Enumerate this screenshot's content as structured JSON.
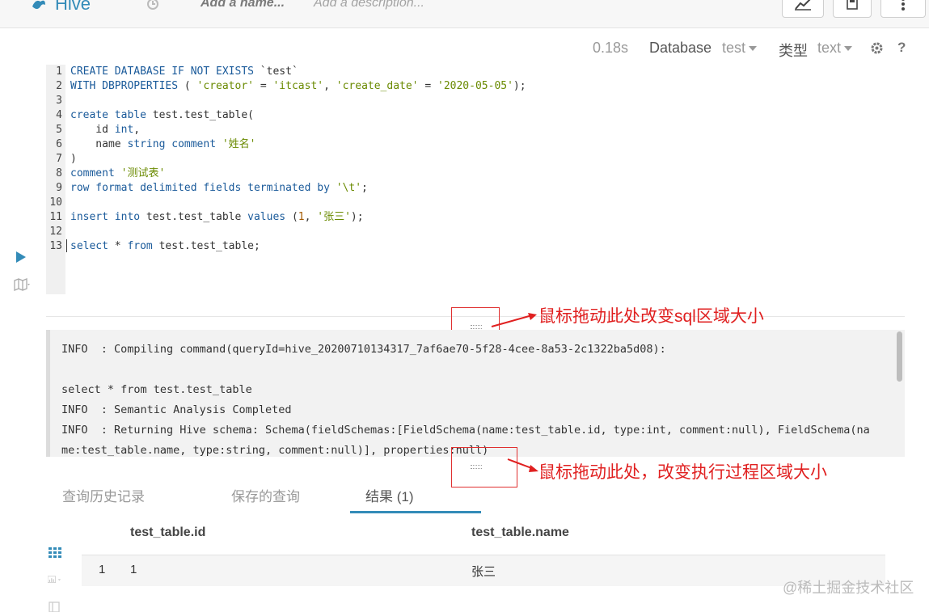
{
  "header": {
    "app_name": "Hive",
    "name_placeholder": "Add a name...",
    "description_placeholder": "Add a description..."
  },
  "toolbar": {
    "elapsed": "0.18s",
    "database_label": "Database",
    "database_value": "test",
    "type_label": "类型",
    "type_value": "text"
  },
  "editor": {
    "line_numbers": [
      "1",
      "2",
      "3",
      "4",
      "5",
      "6",
      "7",
      "8",
      "9",
      "10",
      "11",
      "12",
      "13"
    ]
  },
  "log": {
    "lines": [
      "INFO  : Compiling command(queryId=hive_20200710134317_7af6ae70-5f28-4cee-8a53-2c1322ba5d08):",
      "",
      "select * from test.test_table",
      "INFO  : Semantic Analysis Completed",
      "INFO  : Returning Hive schema: Schema(fieldSchemas:[FieldSchema(name:test_table.id, type:int, comment:null), FieldSchema(na",
      "me:test_table.name, type:string, comment:null)], properties:null)"
    ]
  },
  "annotations": {
    "sql_resize": "鼠标拖动此处改变sql区域大小",
    "log_resize": "鼠标拖动此处，改变执行过程区域大小"
  },
  "tabs": {
    "history": "查询历史记录",
    "saved": "保存的查询",
    "results": "结果 (1)"
  },
  "results": {
    "columns": [
      "test_table.id",
      "test_table.name"
    ],
    "rows": [
      {
        "index": "1",
        "id": "1",
        "name": "张三"
      }
    ]
  },
  "watermark": "@稀土掘金技术社区"
}
